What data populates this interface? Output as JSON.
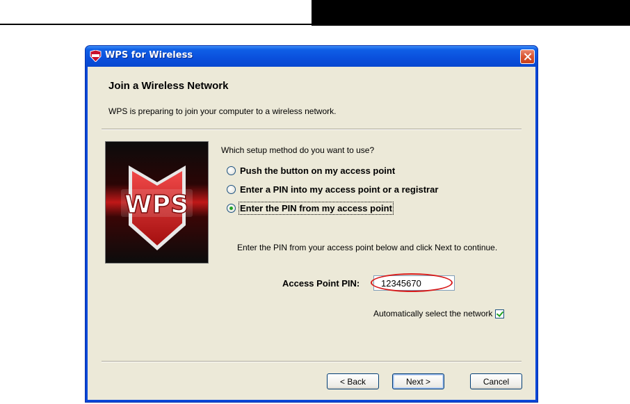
{
  "window": {
    "title": "WPS for Wireless",
    "close_icon": "close-icon"
  },
  "page": {
    "heading": "Join a Wireless Network",
    "subtitle": "WPS is preparing to join your computer to a wireless network."
  },
  "image": {
    "logo_text": "WPS"
  },
  "setup": {
    "question": "Which setup method do you want to use?",
    "options": [
      {
        "label": "Push the button on my access point",
        "checked": false
      },
      {
        "label": "Enter a PIN into my access point or a registrar",
        "checked": false
      },
      {
        "label": "Enter the PIN from my access point",
        "checked": true
      }
    ],
    "instruction": "Enter the PIN from your access point below and click Next to continue.",
    "pin_label": "Access Point PIN:",
    "pin_value": "12345670",
    "auto_select_label": "Automatically select the network",
    "auto_select_checked": true
  },
  "buttons": {
    "back": "< Back",
    "next": "Next >",
    "cancel": "Cancel"
  },
  "colors": {
    "titlebar": "#0a4fdc",
    "client_bg": "#ece9d8",
    "highlight": "#d81b1b",
    "check_green": "#21a121"
  }
}
